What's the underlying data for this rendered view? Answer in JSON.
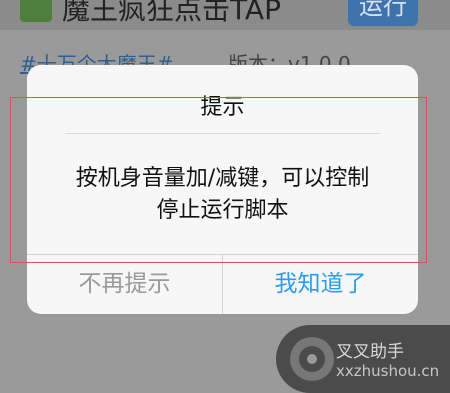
{
  "background_app": {
    "title": "魔王疯狂点击TAP",
    "run_button": "运行",
    "tag_link": "#十万个大魔王#",
    "version": "版本：v1.0.0"
  },
  "dialog": {
    "title": "提示",
    "message_line1": "按机身音量加/减键，可以控制",
    "message_line2": "停止运行脚本",
    "cancel_button": "不再提示",
    "confirm_button": "我知道了"
  },
  "watermark": {
    "name": "叉叉助手",
    "url": "xxzhushou.cn"
  },
  "colors": {
    "confirm_blue": "#2b9cf0",
    "cancel_gray": "#9a9a9a",
    "annotation_red": "#d9534f"
  }
}
